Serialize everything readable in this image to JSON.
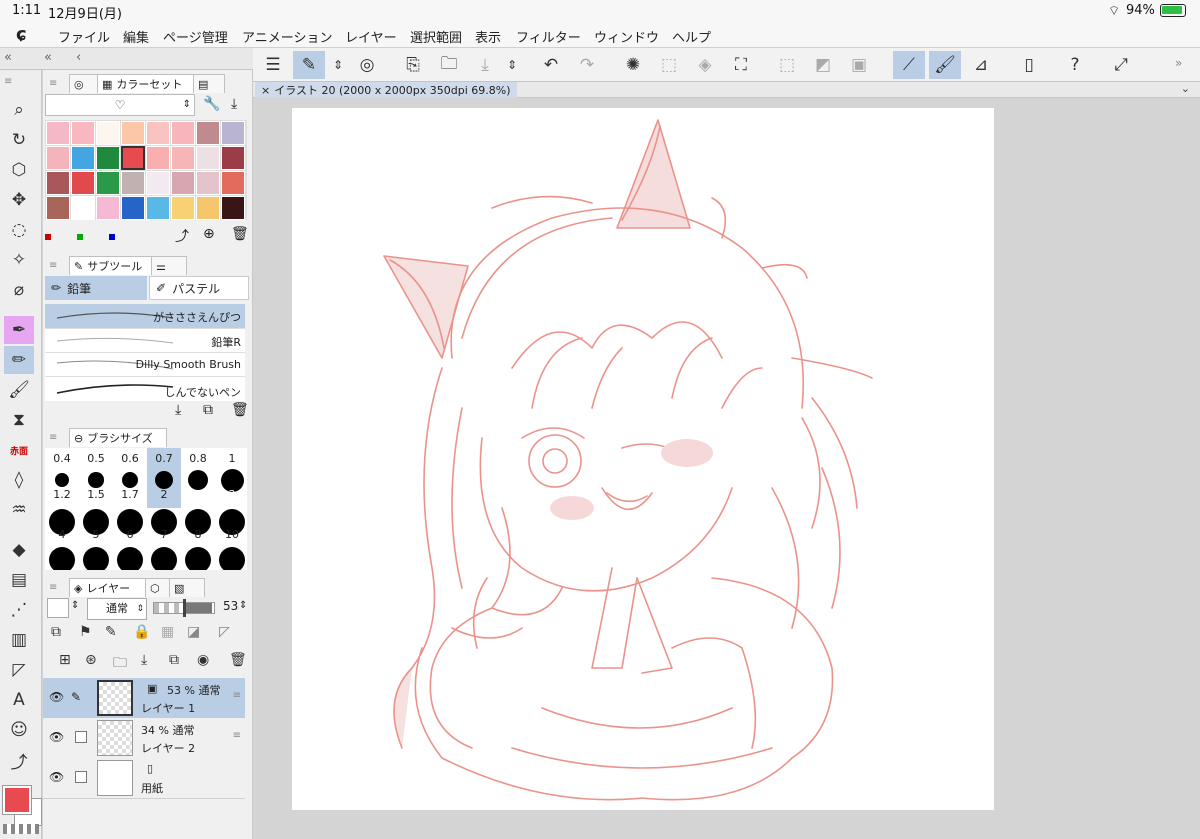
{
  "status": {
    "time": "1:11",
    "date": "12月9日(月)",
    "battery": "94%"
  },
  "menu": [
    "ファイル",
    "編集",
    "ページ管理",
    "アニメーション",
    "レイヤー",
    "選択範囲",
    "表示",
    "フィルター",
    "ウィンドウ",
    "ヘルプ"
  ],
  "document": {
    "tab_label": "イラスト 20 (2000 x 2000px 350dpi 69.8%)"
  },
  "color_set": {
    "tab_label": "カラーセット",
    "set_name": "♡",
    "swatches": [
      "#f5b8c6",
      "#f9b7c0",
      "#fdf6ee",
      "#fbc7a8",
      "#f8c3c1",
      "#f8b6bc",
      "#c08b8e",
      "#b8b4d2",
      "#f5b3bb",
      "#43a6e2",
      "#1f8a3c",
      "#e84b4f",
      "#f8afaf",
      "#f8b5b5",
      "#ede0e4",
      "#9c3c48",
      "#a8585a",
      "#e2494d",
      "#2a9a49",
      "#c2b1b1",
      "#f1eaf0",
      "#d7a7b0",
      "#e3c4cc",
      "#e26b5d",
      "#a8665b",
      "#ffffff",
      "#f6b9d4",
      "#2764c7",
      "#5ab8e6",
      "#f8d173",
      "#f6c66c",
      "#3a1515"
    ]
  },
  "sub_tool": {
    "tab_label": "サブツール",
    "groups": [
      "鉛筆",
      "パステル"
    ],
    "brushes": [
      "がさささえんぴつ",
      "鉛筆R",
      "Dilly Smooth Brush",
      "しんでないペン"
    ]
  },
  "brush_size": {
    "tab_label": "ブラシサイズ",
    "sizes": [
      "0.4",
      "0.5",
      "0.6",
      "0.7",
      "0.8",
      "1",
      "1.2",
      "1.5",
      "1.7",
      "2",
      "2.5",
      "3",
      "4",
      "5",
      "6",
      "7",
      "8",
      "10"
    ]
  },
  "layer_panel": {
    "tab_label": "レイヤー",
    "blend_mode": "通常",
    "opacity": "53",
    "layers": [
      {
        "name": "レイヤー 1",
        "info": "53 % 通常"
      },
      {
        "name": "レイヤー 2",
        "info": "34 % 通常"
      },
      {
        "name": "用紙",
        "info": ""
      }
    ]
  },
  "colors": {
    "main": "#e84b4f",
    "sub": "#ffffff",
    "selected": "#b9cde4",
    "sketch": "#e8877f"
  }
}
